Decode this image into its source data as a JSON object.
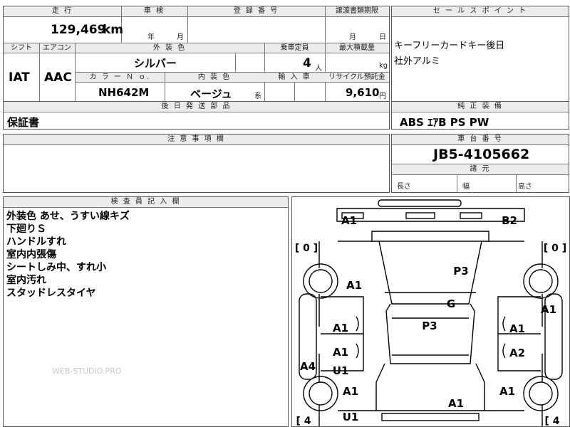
{
  "top": {
    "mileage_header": "走 行",
    "mileage_value": "129,469",
    "mileage_unit": "km",
    "inspection_header": "車 検",
    "inspection_year": "年",
    "inspection_month": "月",
    "registration_header": "登 録 番 号",
    "transfer_header": "譲渡書類期限",
    "transfer_month": "月",
    "transfer_day": "日"
  },
  "row2": {
    "shift_header": "シフト",
    "shift_value": "IAT",
    "ac_header": "エアコン",
    "ac_value": "AAC",
    "ext_color_header": "外 装 色",
    "ext_color_value": "シルバー",
    "capacity_header": "乗車定員",
    "capacity_value": "4",
    "capacity_unit": "人",
    "max_load_header": "最大積載量",
    "max_load_unit": "kg",
    "color_no_header": "カ ラ ー Ｎ ｏ.",
    "color_no_value": "NH642M",
    "int_color_header": "内 装 色",
    "int_color_value": "ベージュ",
    "int_color_suffix": "系",
    "import_header": "輸 入 車",
    "recycle_header": "リサイクル預託金",
    "recycle_value": "9,610",
    "recycle_unit": "円"
  },
  "later_parts": {
    "header": "後 日 発 送 部 品",
    "value": "保証書"
  },
  "cautions": {
    "header": "注 意 事 項 欄",
    "value": ""
  },
  "sales_points": {
    "header": "セ ー ル ス ポ イ ン ト",
    "lines": [
      "キーフリーカードキー後日",
      "社外アルミ"
    ]
  },
  "equipment": {
    "header": "純 正 装 備",
    "value": "ABS ｴｱB PS PW"
  },
  "chassis": {
    "header": "車 台 番 号",
    "value": "JB5-4105662"
  },
  "dimensions": {
    "header": "諸 元",
    "length": "長さ",
    "width": "幅",
    "height": "高さ"
  },
  "inspector": {
    "header": "検 査 員 記 入 欄",
    "notes": [
      "外装色 あせ、うすい線キズ",
      "下廻りＳ",
      "ハンドルすれ",
      "室内内張傷",
      "シートしみ中、すれ小",
      "室内汚れ",
      "スタッドレスタイヤ"
    ]
  },
  "watermark": "WEB-STUDIO.PRO",
  "diagram": {
    "marks": [
      "A1",
      "B2",
      "P3",
      "A1",
      "G",
      "A1",
      "A1",
      "P3",
      "A1",
      "A1",
      "A2",
      "A4",
      "U1",
      "A1",
      "A1",
      "A1",
      "U1"
    ],
    "tire_brackets": [
      "[ 0 ]",
      "[ 0 ]",
      "[ 4",
      "[ 4"
    ]
  }
}
